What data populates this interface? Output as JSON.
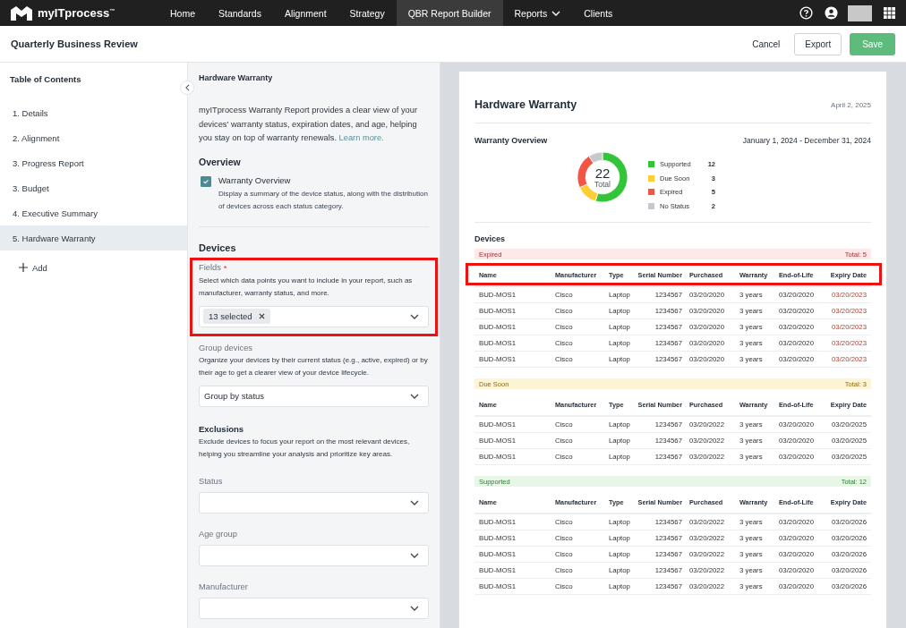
{
  "nav": {
    "logo": "myITprocess$^{™}$",
    "items": [
      {
        "label": "Home",
        "selected": false,
        "dropdown": false
      },
      {
        "label": "Standards",
        "selected": false,
        "dropdown": false
      },
      {
        "label": "Alignment",
        "selected": false,
        "dropdown": false
      },
      {
        "label": "Strategy",
        "selected": false,
        "dropdown": false
      },
      {
        "label": "QBR Report Builder",
        "selected": true,
        "dropdown": false
      },
      {
        "label": "Reports",
        "selected": false,
        "dropdown": true
      },
      {
        "label": "Clients",
        "selected": false,
        "dropdown": false
      }
    ]
  },
  "header": {
    "title": "Quarterly Business Review",
    "buttons": [
      {
        "label": "Cancel",
        "kind": "text"
      },
      {
        "label": "Export",
        "kind": "outline"
      },
      {
        "label": "Save",
        "kind": "primary"
      }
    ]
  },
  "sidebar": {
    "title": "Table of Contents",
    "items": [
      {
        "label": "1. Details",
        "selected": false
      },
      {
        "label": "2. Alignment",
        "selected": false
      },
      {
        "label": "3. Progress Report",
        "selected": false
      },
      {
        "label": "3. Budget",
        "selected": false
      },
      {
        "label": "4. Executive Summary",
        "selected": false
      },
      {
        "label": "5. Hardware Warranty",
        "selected": true
      }
    ],
    "add": "Add"
  },
  "settings": {
    "title": "Hardware Warranty",
    "intro": {
      "text": "myITprocess Warranty Report provides a clear view of your devices' warranty status, expiration dates, and age, helping you stay on top of warranty renewals.",
      "link": "Learn more."
    },
    "overview": {
      "heading": "Overview",
      "option": {
        "label": "Warranty Overview",
        "description": "Display a summary of the device status, along with the distribution of devices across each status category.",
        "checked": true
      }
    },
    "devices": {
      "heading": "Devices",
      "fields": {
        "label": "Fields",
        "required_mark": "*",
        "description": "Select which data points you want to include in your report, such as manufacturer, warranty status, and more.",
        "chip": "13 selected",
        "highlighted": true
      },
      "group": {
        "label": "Group devices",
        "description": "Organize your devices by their current status (e.g., active, expired) or by their age to get a clearer view of your device lifecycle.",
        "value": "Group by status"
      }
    },
    "exclusions": {
      "heading": "Exclusions",
      "description": "Exclude devices to focus your report on the most relevant devices, helping you streamline your analysis and prioritize key areas.",
      "filters": [
        {
          "label": "Status"
        },
        {
          "label": "Age group"
        },
        {
          "label": "Manufacturer"
        }
      ]
    }
  },
  "preview": {
    "title": "Hardware Warranty",
    "date": "April 2, 2025",
    "overview": {
      "title": "Warranty Overview",
      "range": "January 1, 2024 - December 31, 2024",
      "center_value": "22",
      "center_label": "Total",
      "chart_data": {
        "type": "donut",
        "categories": [
          "Supported",
          "Due Soon",
          "Expired",
          "No Status"
        ],
        "values": [
          54.55,
          13.64,
          22.73,
          9.08
        ]
      },
      "legend": [
        {
          "count": "12",
          "color": "#33c43a"
        },
        {
          "count": "3",
          "color": "#fdcd32"
        },
        {
          "count": "5",
          "color": "#f05545"
        },
        {
          "count": "2",
          "color": "#c5c8cd"
        }
      ]
    },
    "devices_title": "Devices",
    "groups": [
      {
        "label": "Expired",
        "total": "Total: 5",
        "kind": "expired",
        "highlighted": true,
        "columns": [
          "Name",
          "Manufacturer",
          "Type",
          "Serial Number",
          "Purchased",
          "Warranty",
          "End-of-Life",
          "Expiry Date"
        ],
        "rows": [
          [
            "BUD-MOS1",
            "Cisco",
            "Laptop",
            "1234567",
            "03/20/2020",
            "3 years",
            "03/20/2020",
            "03/20/2023"
          ],
          [
            "BUD-MOS1",
            "Cisco",
            "Laptop",
            "1234567",
            "03/20/2020",
            "3 years",
            "03/20/2020",
            "03/20/2023"
          ],
          [
            "BUD-MOS1",
            "Cisco",
            "Laptop",
            "1234567",
            "03/20/2020",
            "3 years",
            "03/20/2020",
            "03/20/2023"
          ],
          [
            "BUD-MOS1",
            "Cisco",
            "Laptop",
            "1234567",
            "03/20/2020",
            "3 years",
            "03/20/2020",
            "03/20/2023"
          ],
          [
            "BUD-MOS1",
            "Cisco",
            "Laptop",
            "1234567",
            "03/20/2020",
            "3 years",
            "03/20/2020",
            "03/20/2023"
          ]
        ]
      },
      {
        "label": "Due Soon",
        "total": "Total: 3",
        "kind": "due_soon",
        "highlighted": false,
        "columns": [
          "Name",
          "Manufacturer",
          "Type",
          "Serial Number",
          "Purchased",
          "Warranty",
          "End-of-Life",
          "Expiry Date"
        ],
        "rows": [
          [
            "BUD-MOS1",
            "Cisco",
            "Laptop",
            "1234567",
            "03/20/2022",
            "3 years",
            "03/20/2020",
            "03/20/2025"
          ],
          [
            "BUD-MOS1",
            "Cisco",
            "Laptop",
            "1234567",
            "03/20/2022",
            "3 years",
            "03/20/2020",
            "03/20/2025"
          ],
          [
            "BUD-MOS1",
            "Cisco",
            "Laptop",
            "1234567",
            "03/20/2022",
            "3 years",
            "03/20/2020",
            "03/20/2025"
          ]
        ]
      },
      {
        "label": "Supported",
        "total": "Total: 12",
        "kind": "supported",
        "highlighted": false,
        "columns": [
          "Name",
          "Manufacturer",
          "Type",
          "Serial Number",
          "Purchased",
          "Warranty",
          "End-of-Life",
          "Expiry Date"
        ],
        "rows": [
          [
            "BUD-MOS1",
            "Cisco",
            "Laptop",
            "1234567",
            "03/20/2022",
            "3 years",
            "03/20/2020",
            "03/20/2026"
          ],
          [
            "BUD-MOS1",
            "Cisco",
            "Laptop",
            "1234567",
            "03/20/2022",
            "3 years",
            "03/20/2020",
            "03/20/2026"
          ],
          [
            "BUD-MOS1",
            "Cisco",
            "Laptop",
            "1234567",
            "03/20/2022",
            "3 years",
            "03/20/2020",
            "03/20/2026"
          ],
          [
            "BUD-MOS1",
            "Cisco",
            "Laptop",
            "1234567",
            "03/20/2022",
            "3 years",
            "03/20/2020",
            "03/20/2026"
          ],
          [
            "BUD-MOS1",
            "Cisco",
            "Laptop",
            "1234567",
            "03/20/2022",
            "3 years",
            "03/20/2020",
            "03/20/2026"
          ]
        ]
      }
    ]
  }
}
